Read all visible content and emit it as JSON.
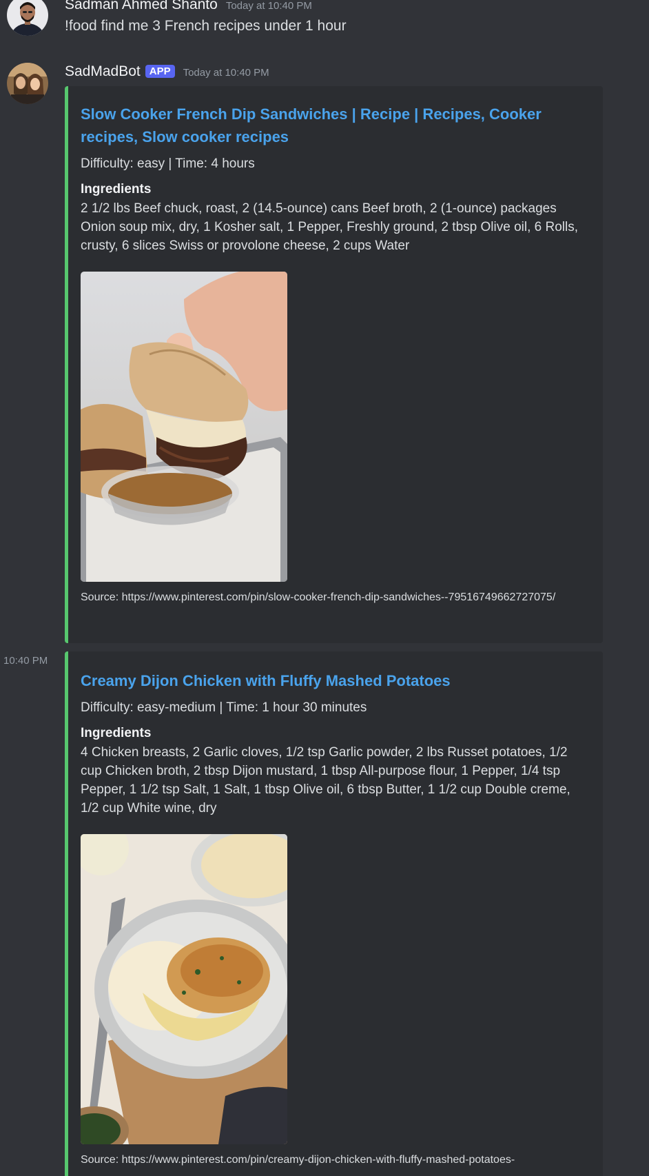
{
  "messages": {
    "user": {
      "name": "Sadman Ahmed Shanto",
      "timestamp": "Today at 10:40 PM",
      "text": "!food find me 3 French recipes under 1 hour"
    },
    "bot": {
      "name": "SadMadBot",
      "badge": "APP",
      "timestamp": "Today at 10:40 PM",
      "side_timestamp": "10:40 PM",
      "embeds": [
        {
          "title": "Slow Cooker French Dip Sandwiches | Recipe | Recipes, Cooker recipes, Slow cooker recipes",
          "meta": "Difficulty: easy | Time: 4 hours",
          "field_name": "Ingredients",
          "field_value": "2 1/2 lbs Beef chuck, roast, 2 (14.5-ounce) cans Beef broth, 2 (1-ounce) packages Onion soup mix, dry, 1 Kosher salt, 1 Pepper, Freshly ground, 2 tbsp Olive oil, 6 Rolls, crusty, 6 slices Swiss or provolone cheese, 2 cups Water",
          "footer": "Source: https://www.pinterest.com/pin/slow-cooker-french-dip-sandwiches--79516749662727075/"
        },
        {
          "title": "Creamy Dijon Chicken with Fluffy Mashed Potatoes",
          "meta": "Difficulty: easy-medium | Time: 1 hour 30 minutes",
          "field_name": "Ingredients",
          "field_value": "4 Chicken breasts, 2 Garlic cloves, 1/2 tsp Garlic powder, 2 lbs Russet potatoes, 1/2 cup Chicken broth, 2 tbsp Dijon mustard, 1 tbsp All-purpose flour, 1 Pepper, 1/4 tsp Pepper, 1 1/2 tsp Salt, 1 Salt, 1 tbsp Olive oil, 6 tbsp Butter, 1 1/2 cup Double creme, 1/2 cup White wine, dry",
          "footer": "Source: https://www.pinterest.com/pin/creamy-dijon-chicken-with-fluffy-mashed-potatoes-"
        }
      ]
    }
  },
  "colors": {
    "background": "#313338",
    "embed_background": "#2b2d31",
    "embed_accent": "#57c76e",
    "link": "#4aa3ec",
    "badge": "#5865f2"
  },
  "icons": {
    "user_avatar": "user-avatar-photo",
    "bot_avatar": "bot-avatar-photo"
  }
}
